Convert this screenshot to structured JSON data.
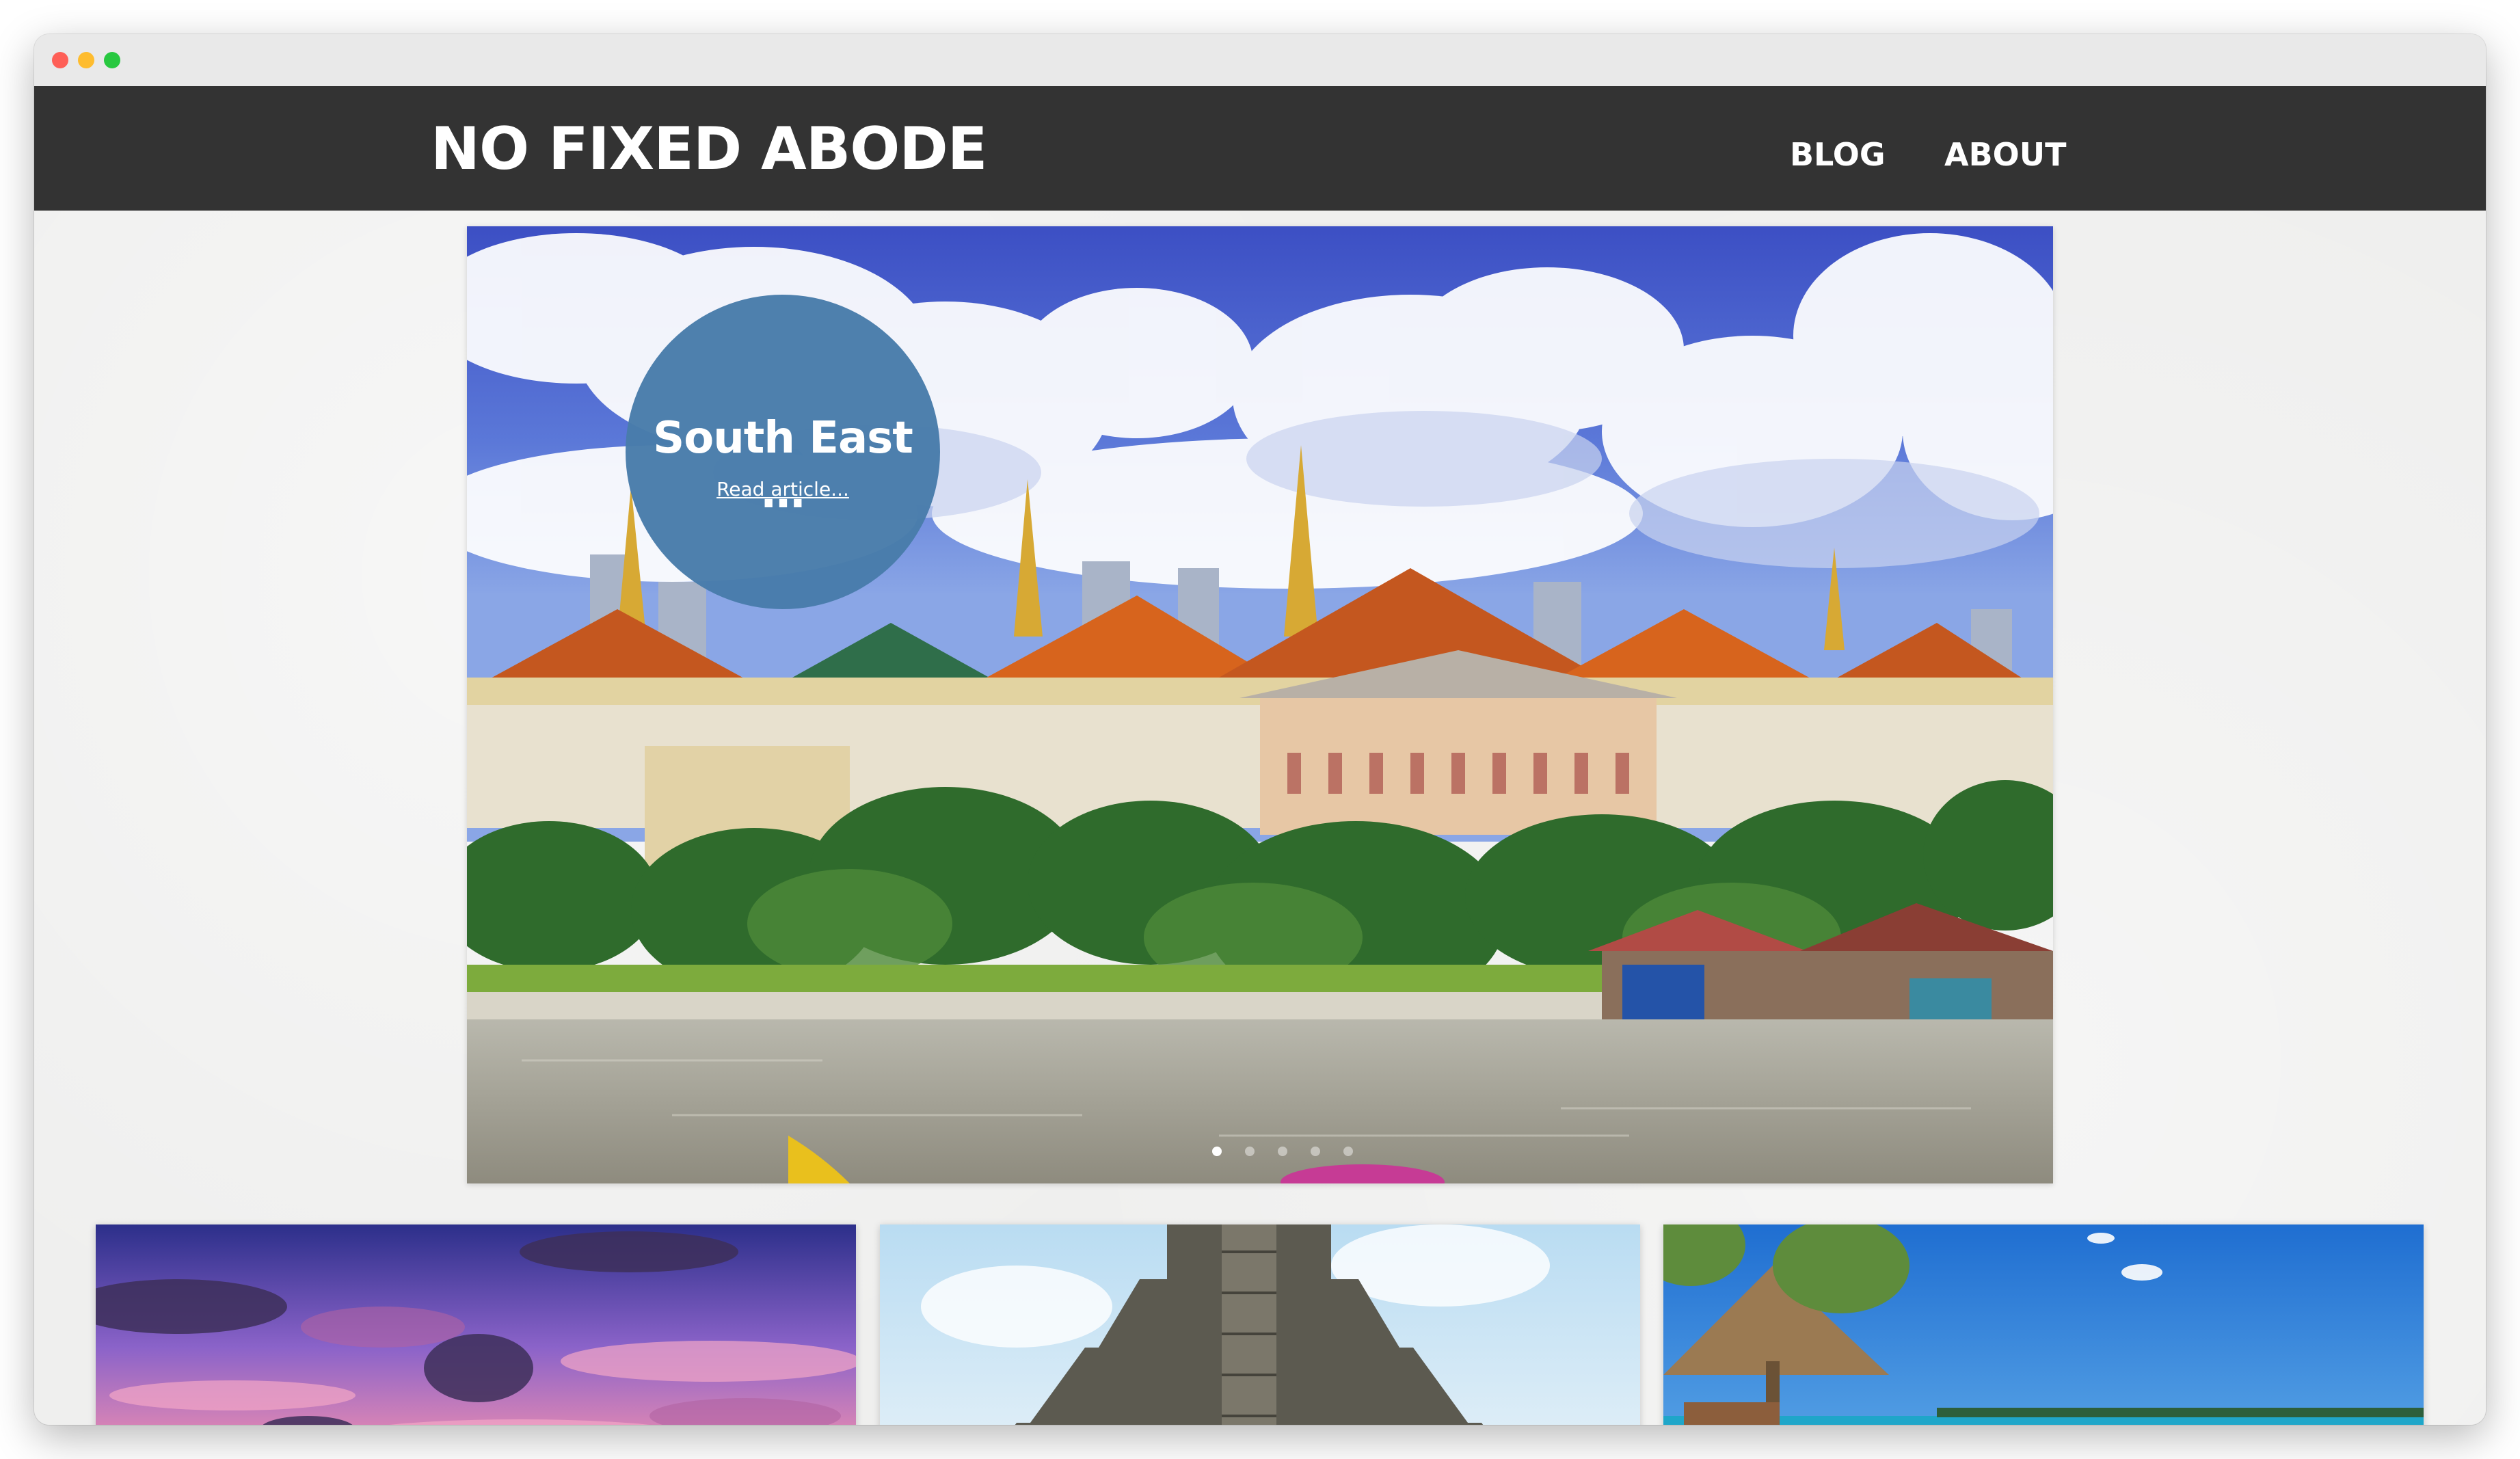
{
  "site": {
    "title": "NO FIXED ABODE"
  },
  "nav": {
    "items": [
      {
        "label": "BLOG"
      },
      {
        "label": "ABOUT"
      }
    ]
  },
  "hero": {
    "badge_title": "South East …",
    "read_link": "Read article...",
    "slide_count": 5,
    "active_slide": 1,
    "image_subject": "Bangkok Grand Palace riverside",
    "badge_color": "#487caa"
  },
  "cards": [
    {
      "image_subject": "pink purple sunset sky"
    },
    {
      "image_subject": "stone temple pyramid"
    },
    {
      "image_subject": "tropical beach with thatched umbrella"
    }
  ],
  "colors": {
    "header_bg": "#333333",
    "page_bg": "#efefee",
    "badge": "#487caa"
  }
}
